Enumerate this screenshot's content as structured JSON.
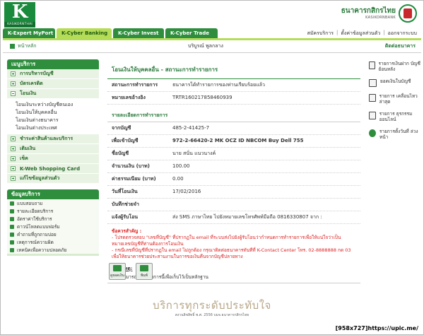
{
  "brand": {
    "logo_letter": "K",
    "logo_text": "KASIKORNTHAI",
    "bank_name_th": "ธนาคารกสิกรไทย",
    "bank_name_en": "KASIKORNBANK",
    "brand_color": "#2f8e3e",
    "accent_color": "#b5dc56"
  },
  "tabs": [
    {
      "label": "K-Expert MyPort"
    },
    {
      "label": "K-Cyber Banking",
      "active": true
    },
    {
      "label": "K-Cyber Invest"
    },
    {
      "label": "K-Cyber Trade"
    }
  ],
  "toplinks": {
    "services": "สมัครบริการ",
    "settings": "ตั้งค่าข้อมูลส่วนตัว",
    "logout": "ออกจากระบบ"
  },
  "crumb": {
    "home": "หน้าหลัก",
    "user": "บริบูรณ์ พูลกลาง",
    "contact": "ติดต่อธนาคาร"
  },
  "sidebar": {
    "menu_title": "เมนูบริการ",
    "items": [
      {
        "label": "การบริหารบัญชี"
      },
      {
        "label": "บัตรเครดิต"
      },
      {
        "label": "โอนเงิน",
        "expanded": true
      }
    ],
    "transfer_sub": [
      "โอนเงินระหว่างบัญชีตนเอง",
      "โอนเงินให้บุคคลอื่น",
      "โอนเงินต่างธนาคาร",
      "โอนเงินต่างประเทศ"
    ],
    "items2": [
      {
        "label": "ชำระค่าสินค้าและบริการ"
      },
      {
        "label": "เติมเงิน"
      },
      {
        "label": "เช็ค"
      },
      {
        "label": "K-Web Shopping Card"
      },
      {
        "label": "แก้ไขข้อมูลส่วนตัว"
      }
    ],
    "service_title": "ข้อมูลบริการ",
    "service_items": [
      "แบบสอบถาม",
      "รายละเอียดบริการ",
      "อัตราค่าใช้บริการ",
      "ดาวน์โหลดแบบฟอร์ม",
      "คำถามที่ถูกถามบ่อย",
      "เหตุการณ์ความผิด",
      "เทคนิคเพื่อความปลอดภัย"
    ]
  },
  "main": {
    "title": "โอนเงินให้บุคคลอื่น - สถานะการทำรายการ",
    "status_rows": [
      {
        "label": "สถานะการทำรายการ",
        "value": "ธนาคารได้ทำรายการของท่านเรียบร้อยแล้ว"
      },
      {
        "label": "หมายเลขอ้างอิง",
        "value": "TRTR160217858460939"
      }
    ],
    "detail_title": "รายละเอียดการทำรายการ",
    "detail_rows": [
      {
        "label": "จากบัญชี",
        "value": "485-2-41425-7",
        "bold": false
      },
      {
        "label": "เพื่อเข้าบัญชี",
        "value": "972-2-66420-2 MK OCZ ID NBCOM Buy Dell 755",
        "bold": true
      },
      {
        "label": "ชื่อบัญชี",
        "value": "นาย สนั่น แนวนางค์",
        "bold": false
      },
      {
        "label": "จำนวนเงิน (บาท)",
        "value": "100.00",
        "bold": false
      },
      {
        "label": "ค่าธรรมเนียม (บาท)",
        "value": "0.00",
        "bold": false
      },
      {
        "label": "วันที่โอนเงิน",
        "value": "17/02/2016",
        "bold": false
      },
      {
        "label": "บันทึกช่วยจำ",
        "value": "",
        "bold": false
      },
      {
        "label": "แจ้งผู้รับโอน",
        "value": "ส่ง SMS ภาษาไทย ไปยังหมายเลขโทรศัพท์มือถือ 0816330807 จาก :",
        "bold": false
      }
    ],
    "warning_title": "ข้อควรสำคัญ :",
    "warning_lines": [
      "- โปรดตรวจสอบ \"เลขที่บัญชี\" ที่ปรากฏใน email ที่ระบบส่งไปยังผู้รับโอนว่ากำหนดการทำรายการเพื่อให้แน่ใจว่าเป็นหมายเลขบัญชีที่ท่านต้องการโอนเงิน",
      "- กรณีเลขที่บัญชีที่ปรากฏใน email ไม่ถูกต้อง กรุณาติดต่อธนาคารทันทีที่ K-Contact Center โทร. 02-8888888 กด 03 เพื่อให้ธนาคารช่วยประสานงานในการขอเงินคืนจากบัญชีปลายทาง"
    ],
    "note_title": "หมายเหตุ:",
    "note_line": "ท่านสามารถพิมพ์รายการนี้เพื่อเก็บไว้เป็นหลักฐาน",
    "btn_save": "ดูยอดเงิน",
    "btn_print": "พิมพ์"
  },
  "quicklinks": [
    {
      "label": "รายการเงินฝาก บัญชีย้อนหลัง",
      "icon": "document-icon"
    },
    {
      "label": "ยอดเงินในบัญชี",
      "icon": "money-icon"
    },
    {
      "label": "รายการ เคลื่อนไหวล่าสุด",
      "icon": "list-icon"
    },
    {
      "label": "รายการ ธุรกรรมออนไลน์",
      "icon": "monitor-icon"
    },
    {
      "label": "รายการตั้งวันที่ ล่วงหน้า",
      "icon": "clock-icon"
    }
  ],
  "footer": {
    "slogan": "บริการทุกระดับประทับใจ",
    "copyright": "สงวนลิขสิทธิ์ พ.ศ. 2556 บมจ.ธนาคารกสิกรไทย",
    "watermark": "[958x727]https://upic.me/"
  }
}
